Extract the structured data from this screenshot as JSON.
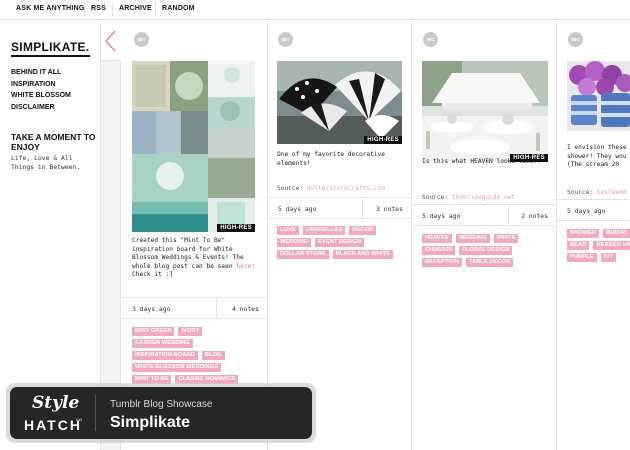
{
  "nav": {
    "links": [
      "ASK ME ANYTHING",
      "RSS",
      "ARCHIVE",
      "RANDOM"
    ]
  },
  "sidebar": {
    "title": "SIMPLIKATE.",
    "links": [
      "BEHIND IT ALL",
      "INSPIRATION",
      "WHITE BLOSSOM",
      "DISCLAIMER"
    ],
    "heading": "TAKE A MOMENT TO ENJOY",
    "tagline": "Life, Love & All Things in Between."
  },
  "avatar_label": "IMG",
  "posts": [
    {
      "badge": "HIGH-RES",
      "caption": "Created this \"Mint To Be\" inspiration board for White Blossom Weddings & Events! The whole blog post can be seen ",
      "caption_link": "here!",
      "caption_end": " Check it :]",
      "date": "3 days ago",
      "notes": "4 notes",
      "tags": [
        "MINT GREEN",
        "IVORY",
        "GARDEN WEDDING",
        "INSPIRATION BOARD",
        "BLOG",
        "WHITE BLOSSOM WEDDINGS",
        "MINT TO BE",
        "CLASSIC ROMANCE"
      ]
    },
    {
      "badge": "HIGH-RES",
      "caption": "One of my favorite decorative elements!",
      "source_label": "Source:",
      "source_link": "dollarstorecrafts.com",
      "date": "5 days ago",
      "notes": "3 notes",
      "tags": [
        "LOVE",
        "UMBRELLAS",
        "DECOR",
        "WEDDING",
        "EVENT DESIGN",
        "DOLLAR STORE",
        "BLACK AND WHITE"
      ]
    },
    {
      "badge": "HIGH-RES",
      "caption": "Is this what HEAVEN looks like?!",
      "source_label": "Source:",
      "source_link": "thebrideguide.net",
      "date": "5 days ago",
      "notes": "2 notes",
      "tags": [
        "HEAVEN",
        "WEDDING",
        "WHITE",
        "CHIAVARI",
        "FLORAL DESIGN",
        "RECEPTION",
        "TABLE DECOR"
      ]
    },
    {
      "caption": "I envision these shower! They wou (The scream 20",
      "source_label": "Source:",
      "source_link": "bestwedd",
      "date": "5 days ago",
      "tags": [
        "SHOWER",
        "BRIDAL",
        "BEAD",
        "BEADED VA",
        "PURPLE",
        "DIY"
      ]
    }
  ],
  "badge": {
    "logo_top": "Style",
    "logo_bottom": "HATCH",
    "logo_co": "CO",
    "showcase": "Tumblr Blog Showcase",
    "blog_name": "Simplikate"
  },
  "colors": {
    "tag_pink": "#f0a9bf",
    "link_pink": "#e8a2b8",
    "badge_dark": "#262626"
  }
}
